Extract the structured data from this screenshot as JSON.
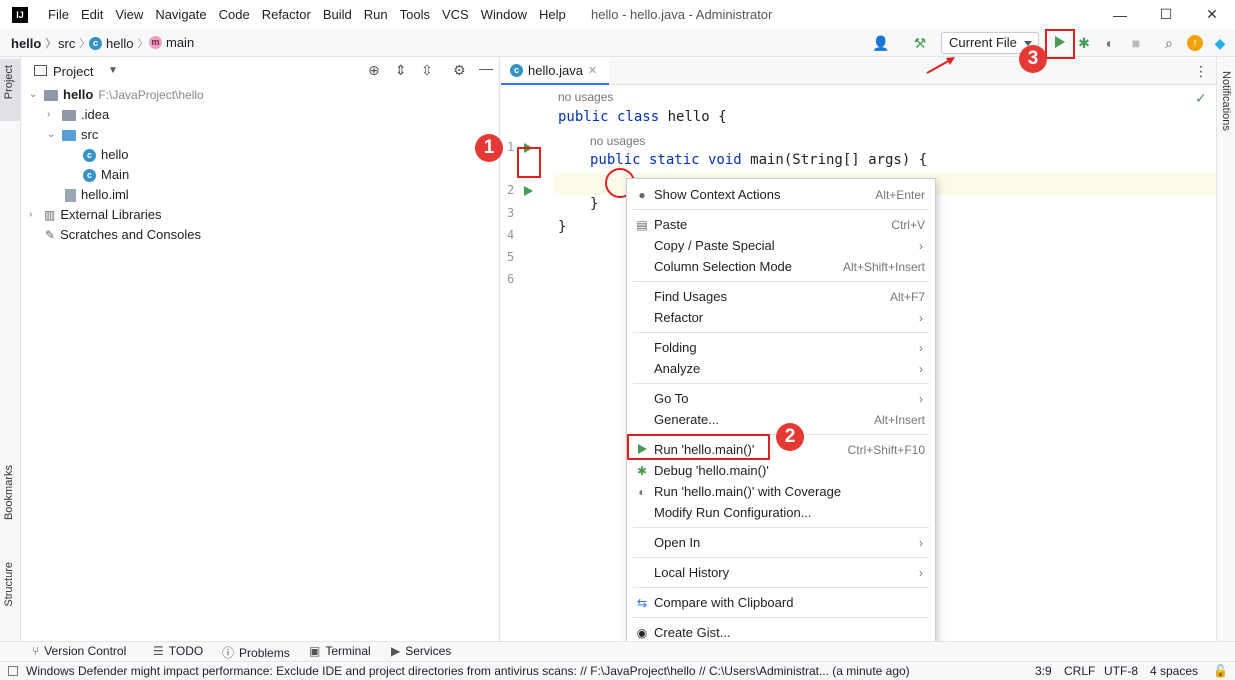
{
  "titlebar": {
    "menu": [
      "File",
      "Edit",
      "View",
      "Navigate",
      "Code",
      "Refactor",
      "Build",
      "Run",
      "Tools",
      "VCS",
      "Window",
      "Help"
    ],
    "window_title": "hello - hello.java - Administrator",
    "minimize": "—",
    "maximize": "☐",
    "close": "✕"
  },
  "navbar": {
    "project": "hello",
    "folder": "src",
    "class": "hello",
    "method": "main",
    "run_config": "Current File"
  },
  "left_strip": {
    "project": "Project",
    "bookmarks": "Bookmarks",
    "structure": "Structure"
  },
  "project_panel": {
    "title": "Project",
    "tree": {
      "root_name": "hello",
      "root_path": "F:\\JavaProject\\hello",
      "idea": ".idea",
      "src": "src",
      "file_hello": "hello",
      "file_main": "Main",
      "iml": "hello.iml",
      "external": "External Libraries",
      "scratches": "Scratches and Consoles"
    }
  },
  "editor": {
    "tab": "hello.java",
    "hint_usages": "no usages",
    "line_numbers": [
      "1",
      "2",
      "3",
      "4",
      "5",
      "6"
    ],
    "code": {
      "l1_kw": "public class",
      "l1_rest": " hello {",
      "l2_kw": "public static void",
      "l2_rest": " main(String[] args) {",
      "l4": "}",
      "l5": "}"
    }
  },
  "right_strip": {
    "notifications": "Notifications"
  },
  "context_menu": {
    "items": [
      {
        "label": "Show Context Actions",
        "shortcut": "Alt+Enter"
      },
      {
        "label": "Paste",
        "shortcut": "Ctrl+V"
      },
      {
        "label": "Copy / Paste Special",
        "shortcut": ""
      },
      {
        "label": "Column Selection Mode",
        "shortcut": "Alt+Shift+Insert"
      },
      {
        "label": "Find Usages",
        "shortcut": "Alt+F7"
      },
      {
        "label": "Refactor",
        "shortcut": ""
      },
      {
        "label": "Folding",
        "shortcut": ""
      },
      {
        "label": "Analyze",
        "shortcut": ""
      },
      {
        "label": "Go To",
        "shortcut": ""
      },
      {
        "label": "Generate...",
        "shortcut": "Alt+Insert"
      },
      {
        "label": "Run 'hello.main()'",
        "shortcut": "Ctrl+Shift+F10"
      },
      {
        "label": "Debug 'hello.main()'",
        "shortcut": ""
      },
      {
        "label": "Run 'hello.main()' with Coverage",
        "shortcut": ""
      },
      {
        "label": "Modify Run Configuration...",
        "shortcut": ""
      },
      {
        "label": "Open In",
        "shortcut": ""
      },
      {
        "label": "Local History",
        "shortcut": ""
      },
      {
        "label": "Compare with Clipboard",
        "shortcut": ""
      },
      {
        "label": "Create Gist...",
        "shortcut": ""
      }
    ]
  },
  "bottom_tools": [
    "Version Control",
    "TODO",
    "Problems",
    "Terminal",
    "Services"
  ],
  "status": {
    "message": "Windows Defender might impact performance: Exclude IDE and project directories from antivirus scans: // F:\\JavaProject\\hello // C:\\Users\\Administrat... (a minute ago)",
    "position": "3:9",
    "line_sep": "CRLF",
    "encoding": "UTF-8",
    "indent": "4 spaces"
  },
  "annotations": [
    "1",
    "2",
    "3"
  ]
}
